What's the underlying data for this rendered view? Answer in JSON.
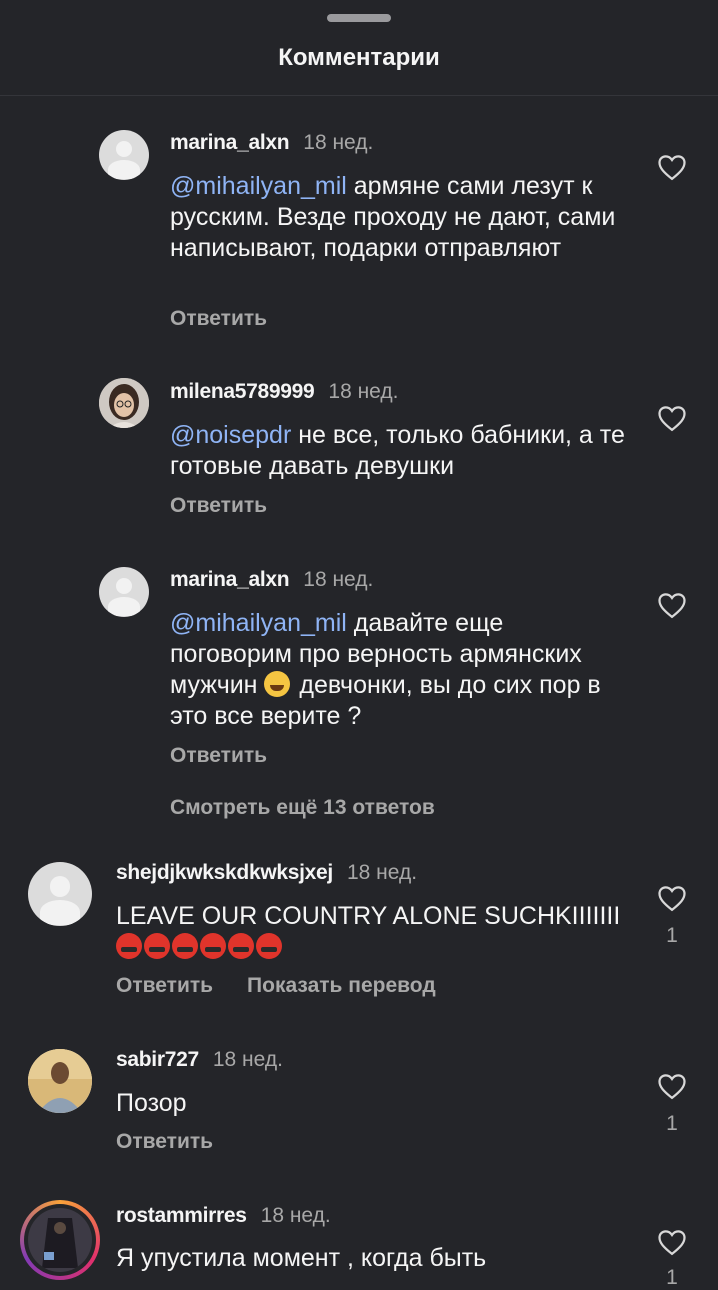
{
  "header": {
    "title": "Комментарии"
  },
  "comments": [
    {
      "user": "marina_alxn",
      "time": "18 нед.",
      "mention": "@mihailyan_mil",
      "text": "армяне сами лезут к русским. Везде проходу не дают, сами написывают, подарки отправляют",
      "reply": "Ответить"
    },
    {
      "user": "milena5789999",
      "time": "18 нед.",
      "mention": "@noisepdr",
      "text": "не все, только бабники, а те готовые давать девушки",
      "reply": "Ответить"
    },
    {
      "user": "marina_alxn",
      "time": "18 нед.",
      "mention": "@mihailyan_mil",
      "text_a": "давайте еще поговорим про верность армянских мужчин",
      "emoji": "face-with-tears-of-joy",
      "text_b": "девчонки, вы до сих пор в это все верите ?",
      "reply": "Ответить"
    },
    {
      "user": "shejdjkwkskdkwksjxej",
      "time": "18 нед.",
      "text": "LEAVE OUR COUNTRY ALONE SUCHKIIIIIII",
      "emoji": "face-with-symbols-on-mouth",
      "likes": "1",
      "reply": "Ответить",
      "translate": "Показать перевод"
    },
    {
      "user": "sabir727",
      "time": "18 нед.",
      "text": "Позор",
      "likes": "1",
      "reply": "Ответить"
    },
    {
      "user": "rostammirres",
      "time": "18 нед.",
      "text": "Я упустила момент , когда быть",
      "likes": "1"
    }
  ],
  "view_more": "Смотреть ещё 13 ответов",
  "colors": {
    "background": "#242529",
    "mention": "#8fb4f5",
    "secondary": "#a8a8a8"
  }
}
